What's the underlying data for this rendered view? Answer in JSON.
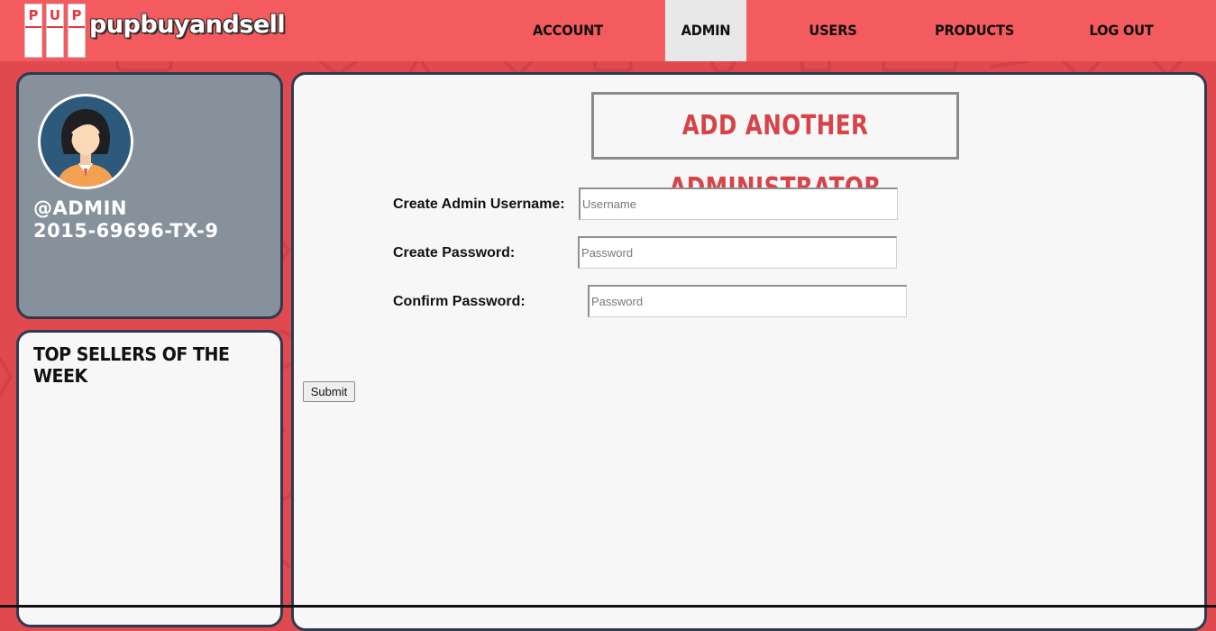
{
  "brand": {
    "logo_letters": [
      "P",
      "U",
      "P"
    ],
    "logo_text": "pupbuyandsell"
  },
  "nav": {
    "items": [
      {
        "label": "ACCOUNT",
        "active": false
      },
      {
        "label": "ADMIN",
        "active": true
      },
      {
        "label": "USERS",
        "active": false
      },
      {
        "label": "PRODUCTS",
        "active": false
      },
      {
        "label": "LOG OUT",
        "active": false
      }
    ]
  },
  "profile": {
    "avatar_icon": "female-user-avatar-icon",
    "username": "@ADMIN",
    "id": "2015-69696-TX-9"
  },
  "sellers": {
    "title": "TOP SELLERS OF THE WEEK"
  },
  "main": {
    "title": "ADD ANOTHER ADMINISTRATOR",
    "form": {
      "username_label": "Create Admin Username:",
      "username_placeholder": "Username",
      "username_value": "",
      "password_label": "Create Password:",
      "password_placeholder": "Password",
      "password_value": "",
      "confirm_label": "Confirm Password:",
      "confirm_placeholder": "Password",
      "confirm_value": "",
      "submit_label": "Submit"
    }
  },
  "colors": {
    "navbar": "#f45b5e",
    "page_background": "#e04a4f",
    "active_tab": "#e8e8e8",
    "title_red": "#d64348",
    "card_border": "#2d3a4f",
    "profile_card": "#86919c"
  }
}
